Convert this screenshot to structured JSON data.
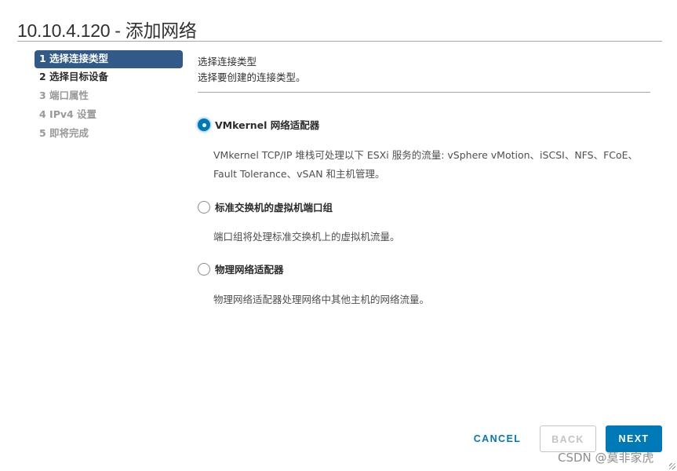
{
  "header": {
    "title": "10.10.4.120 - 添加网络"
  },
  "steps": [
    {
      "label": "1 选择连接类型",
      "state": "active"
    },
    {
      "label": "2 选择目标设备",
      "state": "enabled"
    },
    {
      "label": "3 端口属性",
      "state": "disabled"
    },
    {
      "label": "4 IPv4 设置",
      "state": "disabled"
    },
    {
      "label": "5 即将完成",
      "state": "disabled"
    }
  ],
  "section": {
    "title": "选择连接类型",
    "description": "选择要创建的连接类型。"
  },
  "options": [
    {
      "label": "VMkernel 网络适配器",
      "selected": true,
      "description": "VMkernel TCP/IP 堆栈可处理以下 ESXi 服务的流量: vSphere vMotion、iSCSI、NFS、FCoE、Fault Tolerance、vSAN 和主机管理。"
    },
    {
      "label": "标准交换机的虚拟机端口组",
      "selected": false,
      "description": "端口组将处理标准交换机上的虚拟机流量。"
    },
    {
      "label": "物理网络适配器",
      "selected": false,
      "description": "物理网络适配器处理网络中其他主机的网络流量。"
    }
  ],
  "footer": {
    "cancel_label": "CANCEL",
    "back_label": "BACK",
    "next_label": "NEXT"
  },
  "watermark": "CSDN @莫非家虎",
  "colors": {
    "accent": "#0079b8",
    "active_step": "#315a89"
  }
}
